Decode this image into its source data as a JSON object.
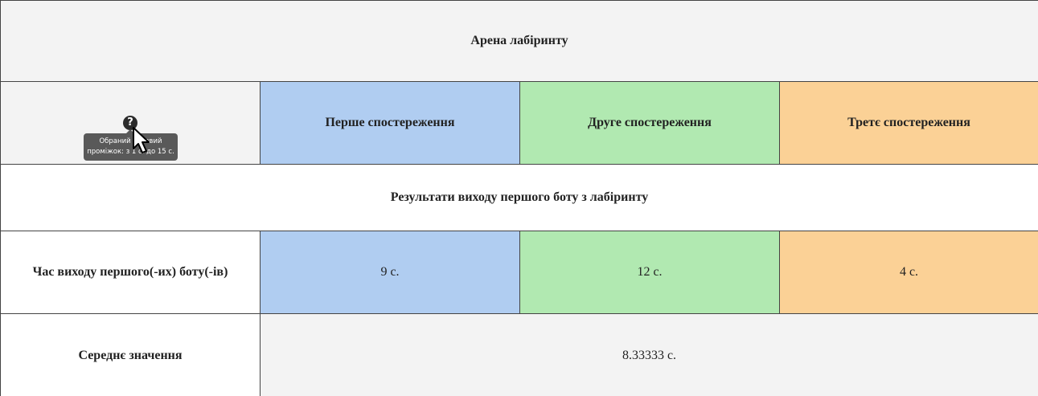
{
  "arena": {
    "title": "Арена лабіринту"
  },
  "help": {
    "icon": "question-circle-icon",
    "tooltip": "Обраний часовий проміжок: з 1 с. до 15 с."
  },
  "observations": {
    "first": "Перше спостереження",
    "second": "Друге спостереження",
    "third": "Третє спостереження"
  },
  "section": {
    "title": "Результати виходу першого боту з лабіринту"
  },
  "exit_time": {
    "label": "Час виходу першого(-их) боту(-ів)",
    "first": "9 с.",
    "second": "12 с.",
    "third": "4 с."
  },
  "average": {
    "label": "Середнє значення",
    "value": "8.33333 с."
  },
  "colors": {
    "first": "#b0cdf1",
    "second": "#b1e9b1",
    "third": "#fbd196",
    "gray": "#f3f3f3"
  }
}
